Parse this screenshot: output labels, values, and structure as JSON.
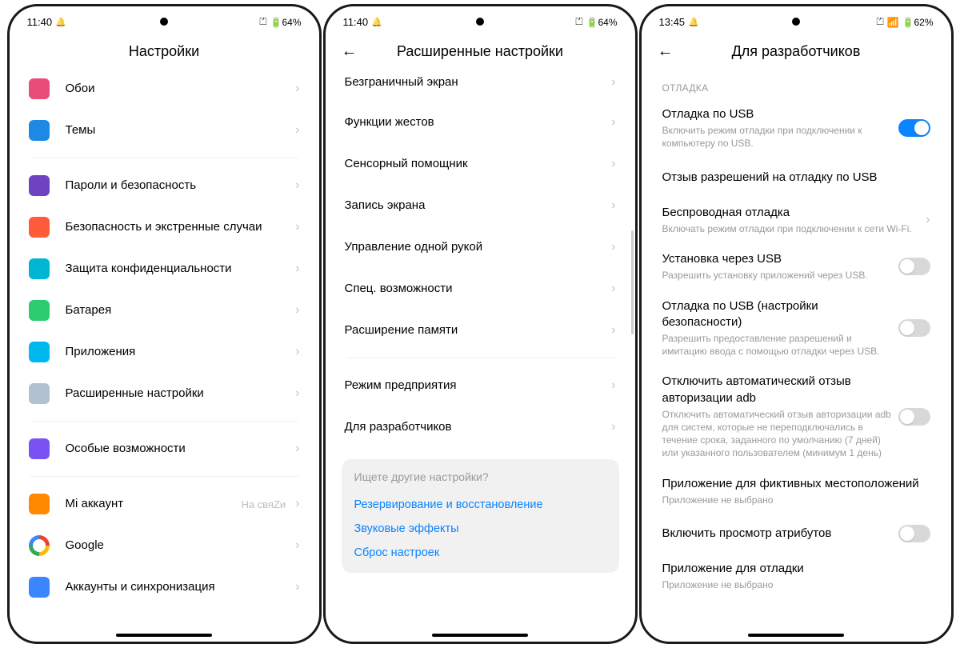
{
  "phones": [
    {
      "status": {
        "time": "11:40",
        "battery": "64%"
      },
      "title": "Настройки",
      "groups": [
        [
          {
            "title": "Обои",
            "iconClass": "c-pink"
          },
          {
            "title": "Темы",
            "iconClass": "c-blue"
          }
        ],
        [
          {
            "title": "Пароли и безопасность",
            "iconClass": "c-purple"
          },
          {
            "title": "Безопасность и экстренные случаи",
            "iconClass": "c-red"
          },
          {
            "title": "Защита конфиденциальности",
            "iconClass": "c-teal"
          },
          {
            "title": "Батарея",
            "iconClass": "c-green"
          },
          {
            "title": "Приложения",
            "iconClass": "c-cyan"
          },
          {
            "title": "Расширенные настройки",
            "iconClass": "c-gray"
          }
        ],
        [
          {
            "title": "Особые возможности",
            "iconClass": "c-violet"
          }
        ],
        [
          {
            "title": "Mi аккаунт",
            "value": "На свяZи",
            "iconClass": "c-orange"
          },
          {
            "title": "Google",
            "iconClass": "google"
          },
          {
            "title": "Аккаунты и синхронизация",
            "iconClass": "c-user"
          }
        ]
      ]
    },
    {
      "status": {
        "time": "11:40",
        "battery": "64%"
      },
      "title": "Расширенные настройки",
      "back": true,
      "listTop": "Безграничный экран",
      "list": [
        "Функции жестов",
        "Сенсорный помощник",
        "Запись экрана",
        "Управление одной рукой",
        "Спец. возможности",
        "Расширение памяти"
      ],
      "list2": [
        "Режим предприятия",
        "Для разработчиков"
      ],
      "suggest": {
        "title": "Ищете другие настройки?",
        "links": [
          "Резервирование и восстановление",
          "Звуковые эффекты",
          "Сброс настроек"
        ]
      }
    },
    {
      "status": {
        "time": "13:45",
        "battery": "62%",
        "wifi": true
      },
      "title": "Для разработчиков",
      "back": true,
      "section": "ОТЛАДКА",
      "items": [
        {
          "title": "Отладка по USB",
          "sub": "Включить режим отладки при подключении к компьютеру по USB.",
          "toggle": true,
          "on": true
        },
        {
          "title": "Отзыв разрешений на отладку по USB"
        },
        {
          "title": "Беспроводная отладка",
          "sub": "Включать режим отладки при подключении к сети Wi-Fi.",
          "chev": true
        },
        {
          "title": "Установка через USB",
          "sub": "Разрешить установку приложений через USB.",
          "toggle": true
        },
        {
          "title": "Отладка по USB (настройки безопасности)",
          "sub": "Разрешить предоставление разрешений и имитацию ввода с помощью отладки через USB.",
          "toggle": true
        },
        {
          "title": "Отключить автоматический отзыв авторизации adb",
          "sub": "Отключить автоматический отзыв авторизации adb для систем, которые не переподключались в течение срока, заданного по умолчанию (7 дней) или указанного пользователем (минимум 1 день)",
          "toggle": true
        },
        {
          "title": "Приложение для фиктивных местоположений",
          "sub": "Приложение не выбрано"
        },
        {
          "title": "Включить просмотр атрибутов",
          "toggle": true
        },
        {
          "title": "Приложение для отладки",
          "sub": "Приложение не выбрано"
        }
      ]
    }
  ]
}
